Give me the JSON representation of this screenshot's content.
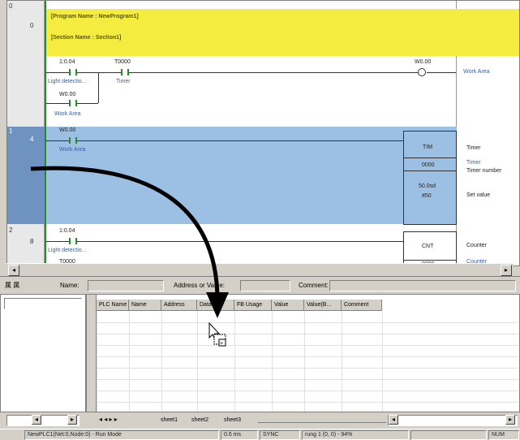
{
  "ladder": {
    "rung_numbers": [
      "0",
      "0",
      "1",
      "4",
      "2",
      "8"
    ],
    "program_comment": "[Program Name : NewProgram1]",
    "section_comment": "[Section Name : Section1]",
    "rung0": {
      "contact1_addr": "1:0.04",
      "contact1_label": "Light detectio...",
      "contact2_addr": "T0000",
      "contact2_label": "Timer",
      "contact3_addr": "W0.00",
      "contact3_label": "Work Area",
      "coil_addr": "W0.00",
      "coil_label": "Work Area"
    },
    "rung1": {
      "contact_addr": "W0.00",
      "contact_label": "Work Area",
      "block_name": "TIM",
      "operand1": "0000",
      "operand1_comment": "Timer",
      "operand2": "50.0sd",
      "operand3": "#50",
      "right_label1": "Timer",
      "right_label2": "Timer",
      "right_label3": "Timer number",
      "right_label4": "Set value"
    },
    "rung2": {
      "contact_addr": "1:0.04",
      "contact_label": "Light detectio...",
      "contact2_addr": "T0000",
      "block_name": "CNT",
      "operand1": "0000",
      "right_label1": "Counter",
      "right_label2": "Counter"
    }
  },
  "addrbar": {
    "prefix": "属 属",
    "name_label": "Name:",
    "address_label": "Address or Value:",
    "comment_label": "Comment:"
  },
  "grid": {
    "columns": [
      "PLC Name",
      "Name",
      "Address",
      "Data T...",
      "FB Usage",
      "Value",
      "Value(B...",
      "Comment"
    ]
  },
  "tabs": [
    "sheet1",
    "sheet2",
    "sheet3"
  ],
  "status": {
    "mode": "NewPLC1(Net:0,Node:0) - Run Mode",
    "cycle": "0.6 ms",
    "sync": "SYNC",
    "rung": "rung 1 (0, 0) - 94%",
    "num": "NUM"
  },
  "colors": {
    "comment_bg": "#f4ec3e",
    "selected_rung": "#9cc0e4",
    "rail": "#2a8a2a"
  },
  "icons": [
    "drag-arrow-icon",
    "drag-copy-cursor-icon",
    "scroll-left-icon",
    "scroll-right-icon"
  ]
}
